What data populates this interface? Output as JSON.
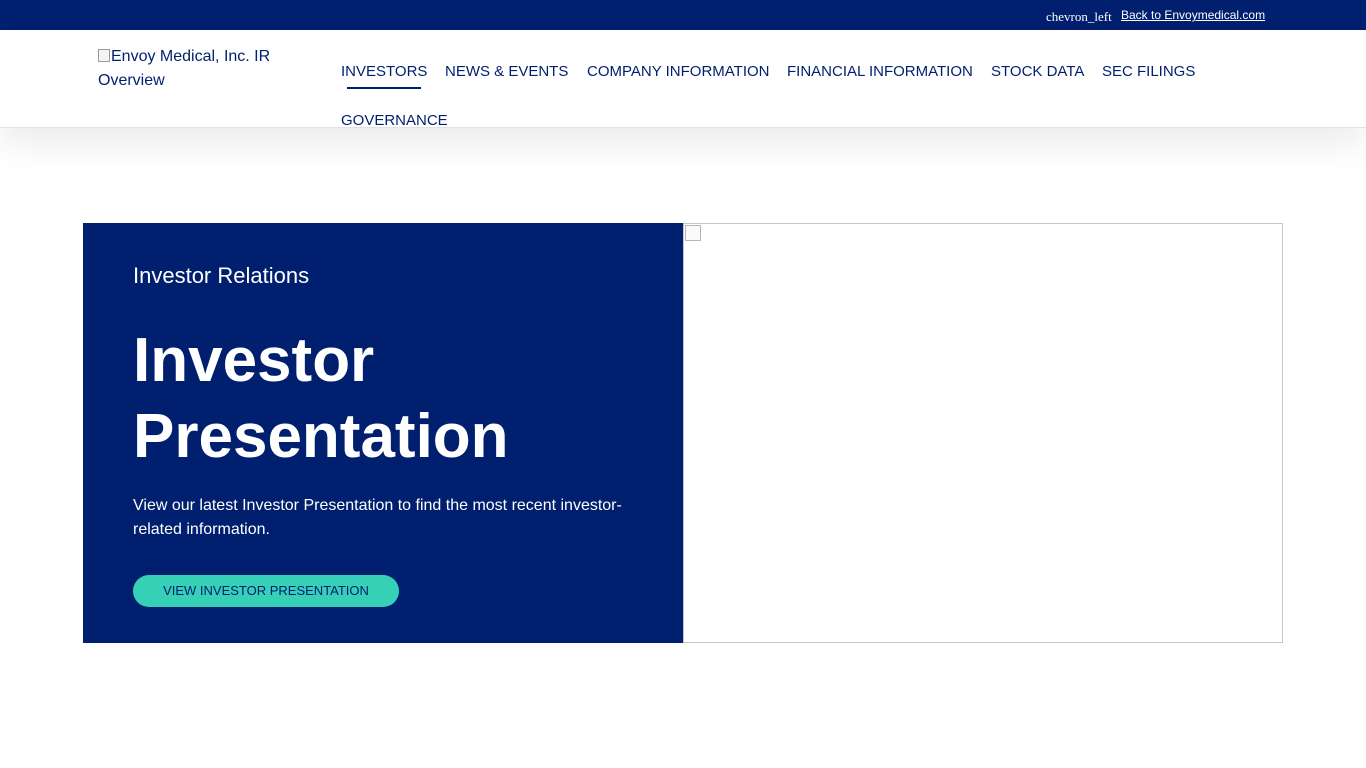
{
  "topbar": {
    "chevron_icon_text": "chevron_left",
    "back_link": " Back to Envoymedical.com"
  },
  "header": {
    "logo_alt": "Envoy Medical, Inc. IR Overview",
    "nav": [
      {
        "label": "INVESTORS",
        "active": true
      },
      {
        "label": "NEWS & EVENTS"
      },
      {
        "label": "COMPANY INFORMATION"
      },
      {
        "label": "FINANCIAL INFORMATION"
      },
      {
        "label": "STOCK DATA"
      },
      {
        "label": "SEC FILINGS"
      },
      {
        "label": "GOVERNANCE"
      }
    ]
  },
  "hero": {
    "eyebrow": "Investor Relations",
    "title": "Investor Presentation",
    "description": "View our latest Investor Presentation to find the most recent investor-related information.",
    "cta_label": "VIEW INVESTOR PRESENTATION"
  },
  "colors": {
    "navy": "#001f6e",
    "teal": "#35d0b6",
    "white": "#ffffff"
  }
}
